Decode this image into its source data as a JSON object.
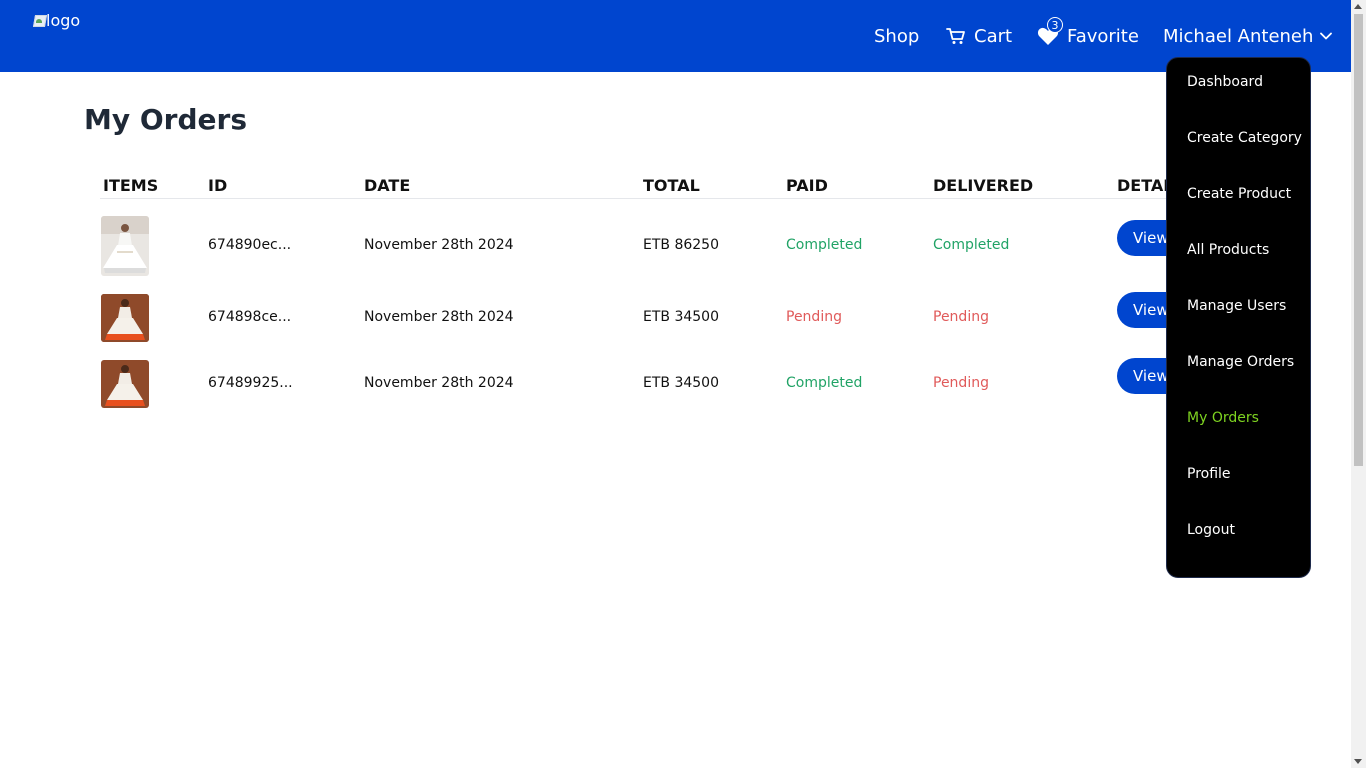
{
  "navbar": {
    "logo_alt": "logo",
    "links": {
      "shop": "Shop",
      "cart": "Cart",
      "favorite": "Favorite",
      "favorite_count": "3",
      "user": "Michael Anteneh"
    }
  },
  "page": {
    "title": "My Orders"
  },
  "table": {
    "headers": {
      "items": "ITEMS",
      "id": "ID",
      "date": "DATE",
      "total": "TOTAL",
      "paid": "PAID",
      "delivered": "DELIVERED",
      "details": "DETAILS"
    },
    "rows": [
      {
        "id": "674890ec...",
        "date": "November 28th 2024",
        "total": "ETB 86250",
        "paid": "Completed",
        "delivered": "Completed",
        "action": "View"
      },
      {
        "id": "674898ce...",
        "date": "November 28th 2024",
        "total": "ETB 34500",
        "paid": "Pending",
        "delivered": "Pending",
        "action": "View"
      },
      {
        "id": "67489925...",
        "date": "November 28th 2024",
        "total": "ETB 34500",
        "paid": "Completed",
        "delivered": "Pending",
        "action": "View"
      }
    ]
  },
  "dropdown": {
    "items": [
      "Dashboard",
      "Create Category",
      "Create Product",
      "All Products",
      "Manage Users",
      "Manage Orders",
      "My Orders",
      "Profile",
      "Logout"
    ],
    "active": "My Orders"
  },
  "colors": {
    "navbar": "#0045cf",
    "status_completed": "#21a366",
    "status_pending": "#e05a5a",
    "active_menu": "#7ed321"
  }
}
